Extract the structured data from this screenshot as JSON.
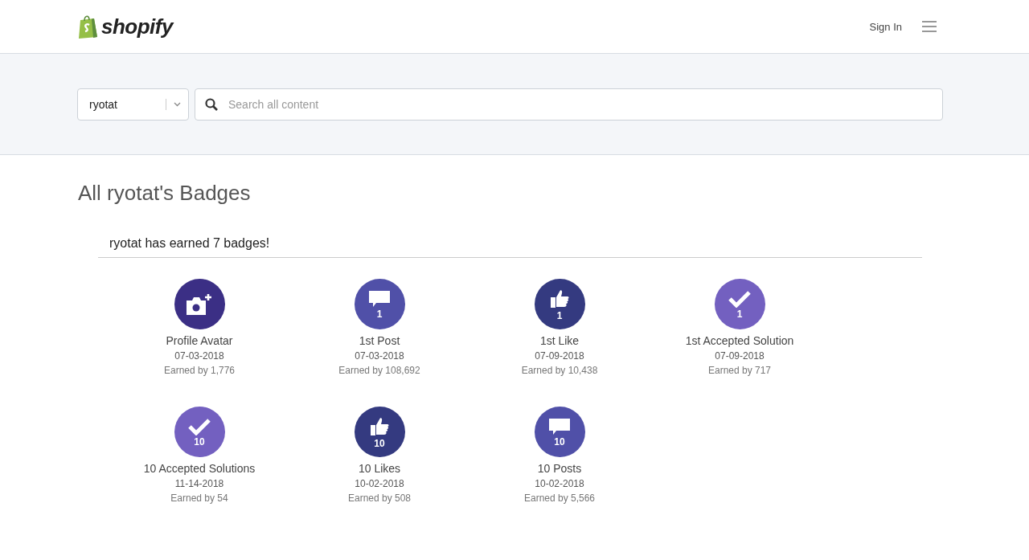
{
  "header": {
    "logo": "shopify",
    "sign_in": "Sign In"
  },
  "search": {
    "scope": "ryotat",
    "placeholder": "Search all content"
  },
  "title": "All ryotat's Badges",
  "summary": "ryotat has earned 7 badges!",
  "badges": [
    {
      "kind": "camera",
      "color": "#3b2f85",
      "name": "Profile Avatar",
      "date": "07-03-2018",
      "earned": "Earned by 1,776"
    },
    {
      "kind": "comment",
      "number": "1",
      "color": "#5050a8",
      "name": "1st Post",
      "date": "07-03-2018",
      "earned": "Earned by 108,692"
    },
    {
      "kind": "like",
      "number": "1",
      "color": "#343a80",
      "name": "1st Like",
      "date": "07-09-2018",
      "earned": "Earned by 10,438"
    },
    {
      "kind": "check",
      "number": "1",
      "color": "#7360c0",
      "name": "1st Accepted Solution",
      "date": "07-09-2018",
      "earned": "Earned by 717"
    },
    {
      "kind": "check",
      "number": "10",
      "color": "#7360c0",
      "name": "10 Accepted Solutions",
      "date": "11-14-2018",
      "earned": "Earned by 54"
    },
    {
      "kind": "like",
      "number": "10",
      "color": "#343a80",
      "name": "10 Likes",
      "date": "10-02-2018",
      "earned": "Earned by 508"
    },
    {
      "kind": "comment",
      "number": "10",
      "color": "#5050a8",
      "name": "10 Posts",
      "date": "10-02-2018",
      "earned": "Earned by 5,566"
    }
  ]
}
